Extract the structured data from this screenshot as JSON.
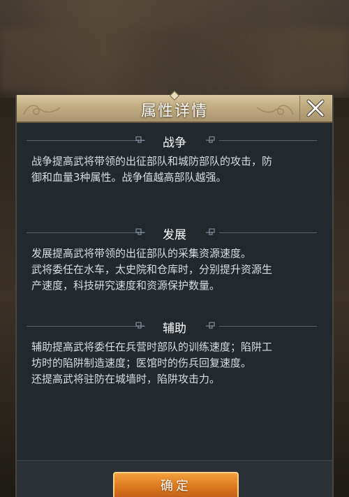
{
  "dialog": {
    "title": "属性详情",
    "close_icon": "close-icon"
  },
  "sections": [
    {
      "label": "战争",
      "lines": [
        "战争提高武将带领的出征部队和城防部队的攻击，防",
        "御和血量3种属性。战争值越高部队越强。"
      ]
    },
    {
      "label": "发展",
      "lines": [
        "发展提高武将带领的出征部队的采集资源速度。",
        "武将委任在水车，太史院和仓库时，分别提升资源生",
        "产速度，科技研究速度和资源保护数量。"
      ]
    },
    {
      "label": "辅助",
      "lines": [
        "辅助提高武将委任在兵营时部队的训练速度；陷阱工",
        "坊时的陷阱制造速度；医馆时的伤兵回复速度。",
        "还提高武将驻防在城墙时，陷阱攻击力。"
      ]
    }
  ],
  "footer": {
    "confirm_label": "确定"
  },
  "colors": {
    "panel_bg": "#23282d",
    "header_gold": "#c2ad82",
    "button_orange": "#d9741c"
  }
}
